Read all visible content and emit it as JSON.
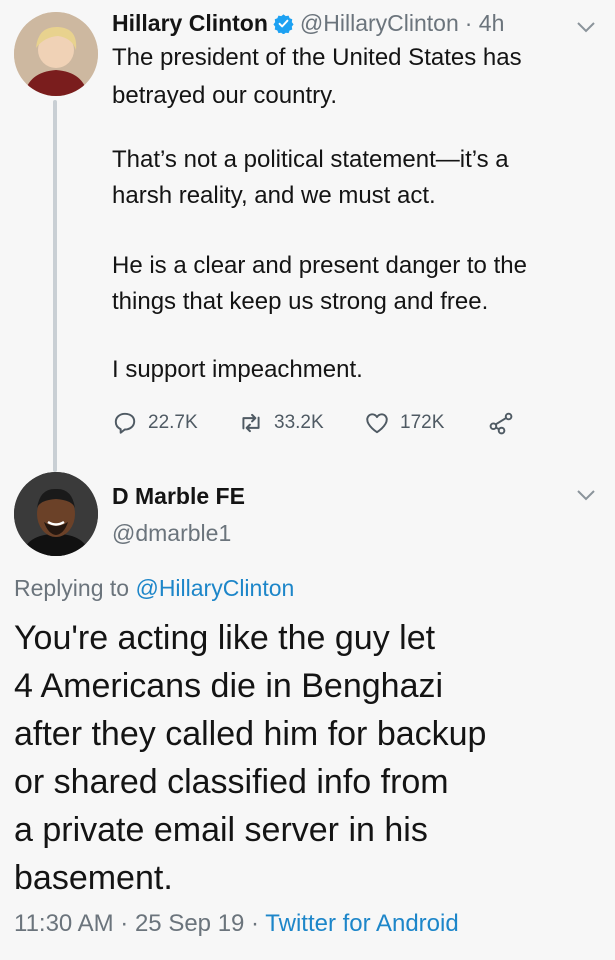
{
  "tweet": {
    "author_name": "Hillary Clinton",
    "handle": "@HillaryClinton",
    "time": "· 4h",
    "lines": [
      "The president of the United States has",
      "betrayed our country.",
      "That’s not a political statement—it’s a",
      "harsh reality, and we must act.",
      "He is a clear and present danger to the",
      "things that keep us strong and free.",
      "I support impeachment."
    ],
    "replies": "22.7K",
    "retweets": "33.2K",
    "likes": "172K",
    "icons": [
      "verified-badge-icon",
      "chevron-down-icon",
      "reply-icon",
      "retweet-icon",
      "like-icon",
      "share-icon"
    ]
  },
  "reply": {
    "author_name": "D Marble FE",
    "handle": "@dmarble1",
    "replying_prefix": "Replying to",
    "replying_to": "@HillaryClinton",
    "lines": [
      "You're acting like the guy let",
      "4 Americans die in Benghazi",
      "after they called him for backup",
      "or shared classified info from",
      "a private email server in his",
      "basement."
    ],
    "time": "11:30 AM",
    "date": "· 25 Sep 19 ·",
    "source": "Twitter for Android"
  },
  "colors": {
    "background": "#f7f7f7",
    "text": "#141414",
    "muted": "#6b747c",
    "link": "#1d86c9",
    "verified": "#1da1f2",
    "thread_line": "#c9cfd4"
  }
}
